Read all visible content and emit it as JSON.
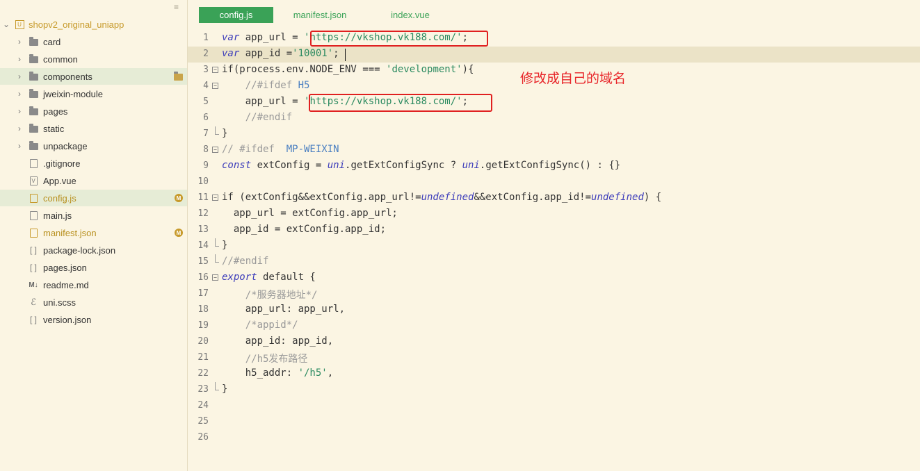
{
  "sidebar": {
    "collapse_glyph": "≡",
    "project": {
      "name": "shopv2_original_uniapp",
      "icon": "uniapp-project-icon"
    },
    "items": [
      {
        "type": "folder",
        "label": "card"
      },
      {
        "type": "folder",
        "label": "common"
      },
      {
        "type": "folder",
        "label": "components"
      },
      {
        "type": "folder",
        "label": "jweixin-module"
      },
      {
        "type": "folder",
        "label": "pages"
      },
      {
        "type": "folder",
        "label": "static"
      },
      {
        "type": "folder",
        "label": "unpackage"
      },
      {
        "type": "file",
        "label": ".gitignore"
      },
      {
        "type": "file",
        "label": "App.vue"
      },
      {
        "type": "file",
        "label": "config.js",
        "badge": "M"
      },
      {
        "type": "file",
        "label": "main.js"
      },
      {
        "type": "file",
        "label": "manifest.json",
        "badge": "M"
      },
      {
        "type": "file",
        "label": "package-lock.json"
      },
      {
        "type": "file",
        "label": "pages.json"
      },
      {
        "type": "file",
        "label": "readme.md"
      },
      {
        "type": "file",
        "label": "uni.scss"
      },
      {
        "type": "file",
        "label": "version.json"
      }
    ]
  },
  "tabs": [
    {
      "label": "config.js",
      "active": true
    },
    {
      "label": "manifest.json",
      "active": false
    },
    {
      "label": "index.vue",
      "active": false
    }
  ],
  "editor": {
    "line_numbers": [
      "1",
      "2",
      "3",
      "4",
      "5",
      "6",
      "7",
      "8",
      "9",
      "10",
      "11",
      "12",
      "13",
      "14",
      "15",
      "16",
      "17",
      "18",
      "19",
      "20",
      "21",
      "22",
      "23",
      "24",
      "25",
      "26"
    ],
    "code": {
      "l1": {
        "kw": "var",
        "a": " app_url = ",
        "s": "'https://vkshop.vk188.com/'",
        "b": ";"
      },
      "l2": {
        "kw": "var",
        "a": " app_id =",
        "s": "'10001'",
        "b": ";"
      },
      "l3": {
        "a": "if(process.env.NODE_ENV === ",
        "s": "'development'",
        "b": "){"
      },
      "l4": {
        "cm": "    //#ifdef ",
        "mac": "H5"
      },
      "l5": {
        "a": "    app_url = ",
        "s": "'https://vkshop.vk188.com/'",
        "b": ";"
      },
      "l6": {
        "cm": "    //#endif"
      },
      "l7": {
        "a": "}"
      },
      "l8": {
        "cm": "// #ifdef  ",
        "mac": "MP-WEIXIN"
      },
      "l9": {
        "kw": "const",
        "a": " extConfig = ",
        "i1": "uni",
        "b": ".getExtConfigSync ? ",
        "i2": "uni",
        "c": ".getExtConfigSync() : {}"
      },
      "l11": {
        "a": "if (extConfig&&extConfig.app_url!=",
        "i1": "undefined",
        "b": "&&extConfig.app_id!=",
        "i2": "undefined",
        "c": ") {"
      },
      "l12": {
        "a": "  app_url = extConfig.app_url;"
      },
      "l13": {
        "a": "  app_id = extConfig.app_id;"
      },
      "l14": {
        "a": "}"
      },
      "l15": {
        "cm": "//#endif"
      },
      "l16": {
        "kw": "export",
        "a": " default {"
      },
      "l17": {
        "cm": "    /*服务器地址*/"
      },
      "l18": {
        "a": "    app_url: app_url,"
      },
      "l19": {
        "cm": "    /*appid*/"
      },
      "l20": {
        "a": "    app_id: app_id,"
      },
      "l21": {
        "cm": "    //h5发布路径"
      },
      "l22": {
        "a": "    h5_addr: ",
        "s": "'/h5'",
        "b": ","
      },
      "l23": {
        "a": "}"
      }
    },
    "annotation": "修改成自己的域名"
  },
  "colors": {
    "background": "#fbf5e3",
    "accent": "#3aa257",
    "highlight_box": "#e02020",
    "annotation": "#e8262a",
    "modified_badge": "#c79a2b"
  }
}
